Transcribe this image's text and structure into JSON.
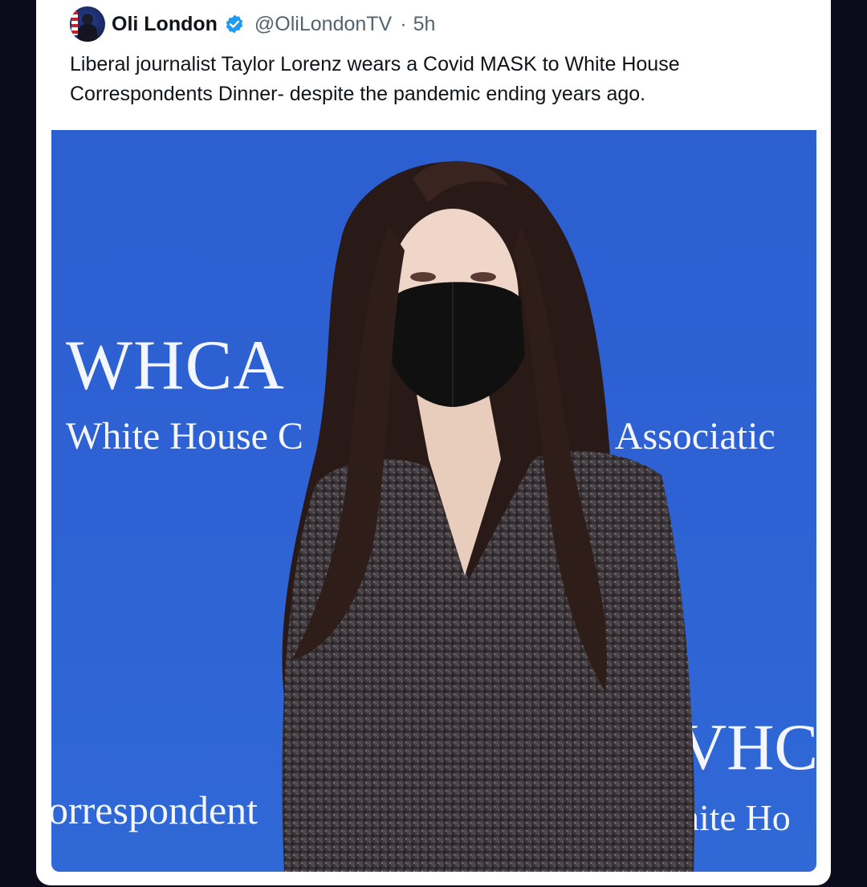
{
  "tweet": {
    "author_name": "Oli London",
    "handle": "@OliLondonTV",
    "separator": "·",
    "time": "5h",
    "text": "Liberal journalist Taylor Lorenz wears a Covid MASK to White House Correspondents Dinner- despite the pandemic ending years ago."
  },
  "photo": {
    "backdrop": {
      "logo_big": "WHCA",
      "line_left": "White House C",
      "line_right": "’ Associatic",
      "bottom_left": "orrespondent",
      "bottom_right_big": "VHC",
      "bottom_right": "hite Ho"
    }
  },
  "colors": {
    "page_background": "#0c0b1c",
    "card": "#ffffff",
    "backdrop_blue": "#2e62d4",
    "verified_badge": "#1d9bf0",
    "handle_gray": "#536471"
  }
}
